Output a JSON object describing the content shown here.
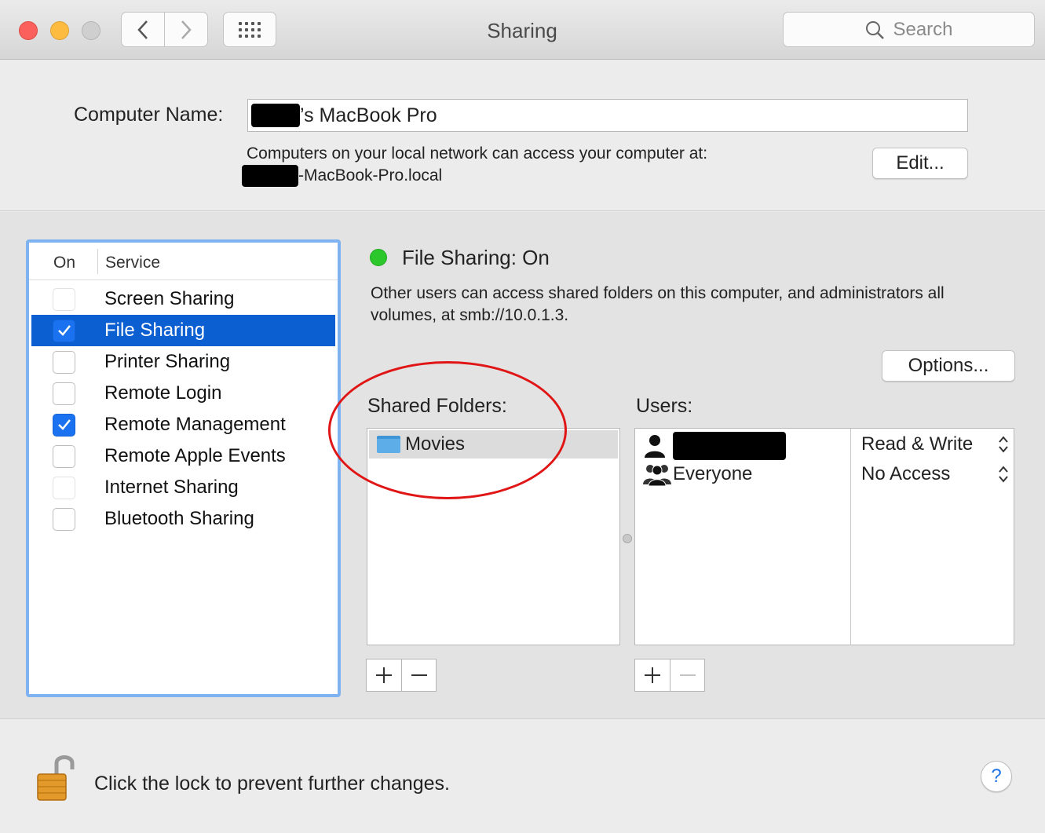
{
  "window": {
    "title": "Sharing"
  },
  "toolbar": {
    "search_placeholder": "Search"
  },
  "computer_name": {
    "label": "Computer Name:",
    "value_suffix": "’s MacBook Pro",
    "access_line1": "Computers on your local network can access your computer at:",
    "access_host_suffix": "-MacBook-Pro.local",
    "edit_button": "Edit..."
  },
  "services": {
    "header_on": "On",
    "header_service": "Service",
    "items": [
      {
        "label": "Screen Sharing",
        "checked": false,
        "selected": false
      },
      {
        "label": "File Sharing",
        "checked": true,
        "selected": true
      },
      {
        "label": "Printer Sharing",
        "checked": false,
        "selected": false
      },
      {
        "label": "Remote Login",
        "checked": false,
        "selected": false
      },
      {
        "label": "Remote Management",
        "checked": true,
        "selected": false
      },
      {
        "label": "Remote Apple Events",
        "checked": false,
        "selected": false
      },
      {
        "label": "Internet Sharing",
        "checked": false,
        "selected": false
      },
      {
        "label": "Bluetooth Sharing",
        "checked": false,
        "selected": false
      }
    ]
  },
  "detail": {
    "status": "File Sharing: On",
    "status_color": "#2cc72a",
    "description": "Other users can access shared folders on this computer, and administrators all volumes, at smb://10.0.1.3.",
    "options_button": "Options...",
    "shared_folders_label": "Shared Folders:",
    "folders": [
      "Movies"
    ],
    "users_label": "Users:",
    "users": [
      {
        "name": "",
        "permission": "Read & Write"
      },
      {
        "name": "Everyone",
        "permission": "No Access"
      }
    ]
  },
  "footer": {
    "lock_text": "Click the lock to prevent further changes.",
    "help_label": "?"
  },
  "colors": {
    "accent": "#0b5fd1",
    "annotation": "#e01616"
  }
}
